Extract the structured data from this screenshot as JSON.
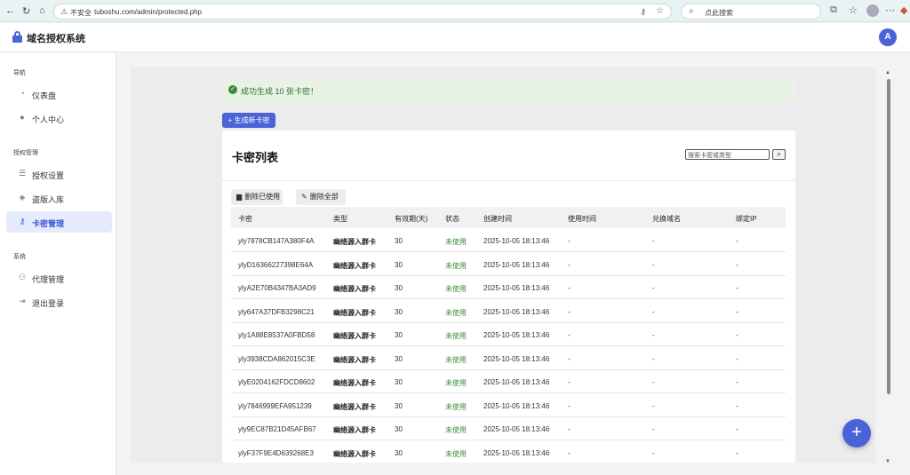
{
  "browser": {
    "insecure_label": "不安全",
    "url": "tuboshu.com/admin/protected.php",
    "search_placeholder": "点此搜索"
  },
  "header": {
    "title": "域名授权系统",
    "avatar_letter": "A"
  },
  "sidebar": {
    "sections": [
      {
        "label": "导航",
        "items": [
          {
            "label": "仪表盘",
            "icon": "dashboard-icon"
          },
          {
            "label": "个人中心",
            "icon": "user-icon"
          }
        ]
      },
      {
        "label": "授权管理",
        "items": [
          {
            "label": "授权设置",
            "icon": "sliders-icon"
          },
          {
            "label": "盗版入库",
            "icon": "shield-icon"
          },
          {
            "label": "卡密管理",
            "icon": "key-icon",
            "active": true
          }
        ]
      },
      {
        "label": "系统",
        "items": [
          {
            "label": "代理管理",
            "icon": "users-icon"
          },
          {
            "label": "退出登录",
            "icon": "logout-icon"
          }
        ]
      }
    ]
  },
  "alert": {
    "message": "成功生成 10 张卡密！"
  },
  "generate_button": "+ 生成新卡密",
  "card": {
    "title": "卡密列表",
    "search_placeholder": "搜索卡密或类型",
    "delete_used": "删除已使用",
    "delete_all": "删除全部"
  },
  "table": {
    "headers": [
      "卡密",
      "类型",
      "有效期(天)",
      "状态",
      "创建时间",
      "使用时间",
      "兑换域名",
      "绑定IP"
    ],
    "rows": [
      [
        "yly7878CB147A380F4A",
        "幽络源入群卡",
        "30",
        "未使用",
        "2025-10-05 18:13:46",
        "-",
        "-",
        "-"
      ],
      [
        "ylyD16366227398E64A",
        "幽络源入群卡",
        "30",
        "未使用",
        "2025-10-05 18:13:46",
        "-",
        "-",
        "-"
      ],
      [
        "ylyA2E70B4347BA3AD9",
        "幽络源入群卡",
        "30",
        "未使用",
        "2025-10-05 18:13:46",
        "-",
        "-",
        "-"
      ],
      [
        "yly647A37DFB3298C21",
        "幽络源入群卡",
        "30",
        "未使用",
        "2025-10-05 18:13:46",
        "-",
        "-",
        "-"
      ],
      [
        "yly1A88E8537A0FBD58",
        "幽络源入群卡",
        "30",
        "未使用",
        "2025-10-05 18:13:46",
        "-",
        "-",
        "-"
      ],
      [
        "yly3938CDA862015C3E",
        "幽络源入群卡",
        "30",
        "未使用",
        "2025-10-05 18:13:46",
        "-",
        "-",
        "-"
      ],
      [
        "ylyE0204162FDCD8602",
        "幽络源入群卡",
        "30",
        "未使用",
        "2025-10-05 18:13:46",
        "-",
        "-",
        "-"
      ],
      [
        "yly7846999EFA951239",
        "幽络源入群卡",
        "30",
        "未使用",
        "2025-10-05 18:13:46",
        "-",
        "-",
        "-"
      ],
      [
        "yly9EC87B21D45AFB67",
        "幽络源入群卡",
        "30",
        "未使用",
        "2025-10-05 18:13:46",
        "-",
        "-",
        "-"
      ],
      [
        "ylyF37F9E4D639268E3",
        "幽络源入群卡",
        "30",
        "未使用",
        "2025-10-05 18:13:46",
        "-",
        "-",
        "-"
      ]
    ]
  },
  "fab_label": "+"
}
